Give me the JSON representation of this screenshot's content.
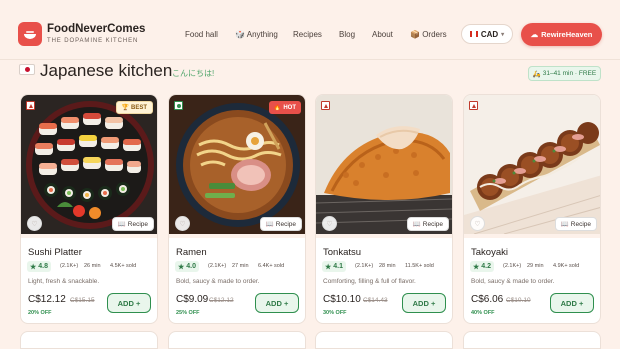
{
  "brand": {
    "name": "FoodNeverComes",
    "tagline": "THE DOPAMINE KITCHEN",
    "logo_icon": "bowl-icon"
  },
  "nav": {
    "food_hall": "Food hall",
    "anything": "Anything",
    "recipes": "Recipes",
    "blog": "Blog",
    "about": "About",
    "orders": "Orders"
  },
  "currency": {
    "value": "CAD"
  },
  "cta": {
    "label": "RewireHeaven"
  },
  "page": {
    "title": "Japanese kitchen",
    "subtitle": "こんにちは!",
    "eta": "31–41 min · FREE"
  },
  "recipe_label": "Recipe",
  "add_label": "ADD +",
  "colors": {
    "accent": "#e8504a",
    "green": "#2f8f4e",
    "background": "#fdf1ea"
  },
  "items": [
    {
      "name": "Sushi Platter",
      "rating": "4.8",
      "reviews": "(2.1K+)",
      "time": "26 min",
      "sold": "4.5K+ sold",
      "desc": "Light, fresh & snackable.",
      "price": "C$12.12",
      "old_price": "C$15.15",
      "discount": "20% OFF",
      "badge": "BEST",
      "veg": "non-veg"
    },
    {
      "name": "Ramen",
      "rating": "4.0",
      "reviews": "(2.1K+)",
      "time": "27 min",
      "sold": "6.4K+ sold",
      "desc": "Bold, saucy & made to order.",
      "price": "C$9.09",
      "old_price": "C$12.12",
      "discount": "25% OFF",
      "badge": "HOT",
      "veg": "veg"
    },
    {
      "name": "Tonkatsu",
      "rating": "4.1",
      "reviews": "(2.1K+)",
      "time": "28 min",
      "sold": "11.5K+ sold",
      "desc": "Comforting, filling & full of flavor.",
      "price": "C$10.10",
      "old_price": "C$14.43",
      "discount": "30% OFF",
      "badge": "",
      "veg": "non-veg"
    },
    {
      "name": "Takoyaki",
      "rating": "4.2",
      "reviews": "(2.1K+)",
      "time": "29 min",
      "sold": "4.9K+ sold",
      "desc": "Bold, saucy & made to order.",
      "price": "C$6.06",
      "old_price": "C$10.10",
      "discount": "40% OFF",
      "badge": "",
      "veg": "non-veg"
    }
  ]
}
